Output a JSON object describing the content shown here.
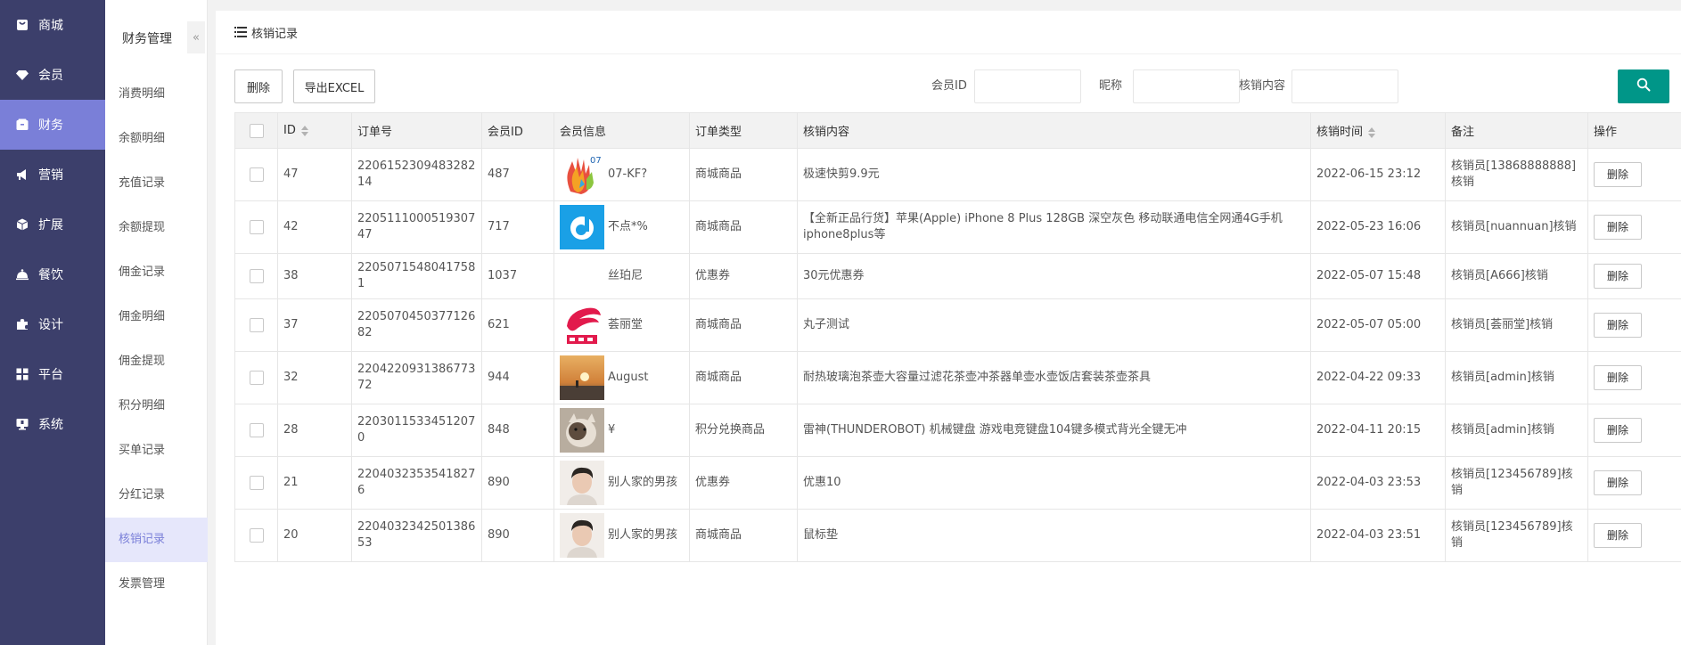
{
  "main_nav": [
    {
      "label": "商城",
      "icon": "bag-icon"
    },
    {
      "label": "会员",
      "icon": "diamond-icon"
    },
    {
      "label": "财务",
      "icon": "wallet-icon"
    },
    {
      "label": "营销",
      "icon": "megaphone-icon"
    },
    {
      "label": "扩展",
      "icon": "cube-icon"
    },
    {
      "label": "餐饮",
      "icon": "cloche-icon"
    },
    {
      "label": "设计",
      "icon": "puzzle-icon"
    },
    {
      "label": "平台",
      "icon": "grid-icon"
    },
    {
      "label": "系统",
      "icon": "monitor-icon"
    }
  ],
  "active_main_nav": "财务",
  "sub_nav": {
    "title": "财务管理",
    "collapse_glyph": "«",
    "items": [
      "消费明细",
      "余额明细",
      "充值记录",
      "余额提现",
      "佣金记录",
      "佣金明细",
      "佣金提现",
      "积分明细",
      "买单记录",
      "分红记录",
      "核销记录",
      "发票管理"
    ],
    "active": "核销记录"
  },
  "page": {
    "title": "核销记录"
  },
  "toolbar": {
    "delete_label": "删除",
    "export_label": "导出EXCEL",
    "filters": [
      {
        "label": "会员ID",
        "value": ""
      },
      {
        "label": "昵称",
        "value": ""
      },
      {
        "label": "核销内容",
        "value": ""
      }
    ],
    "accent_color": "#009688"
  },
  "table": {
    "columns": [
      "ID",
      "订单号",
      "会员ID",
      "会员信息",
      "订单类型",
      "核销内容",
      "核销时间",
      "备注",
      "操作"
    ],
    "sortable_columns": [
      "ID",
      "核销时间"
    ],
    "action_label": "删除",
    "rows": [
      {
        "id": "47",
        "order_no": "220615230948328214",
        "member_id": "487",
        "nickname": "07-KF?",
        "avatar": "colorful-hands",
        "order_type": "商城商品",
        "content": "极速快剪9.9元",
        "time": "2022-06-15 23:12",
        "remark": "核销员[13868888888]核销"
      },
      {
        "id": "42",
        "order_no": "220511100051930747",
        "member_id": "717",
        "nickname": "不点*%",
        "avatar": "blue-logo",
        "order_type": "商城商品",
        "content": "【全新正品行货】苹果(Apple) iPhone 8 Plus 128GB 深空灰色 移动联通电信全网通4G手机 iphone8plus等",
        "time": "2022-05-23 16:06",
        "remark": "核销员[nuannuan]核销"
      },
      {
        "id": "38",
        "order_no": "220507154804175​81",
        "member_id": "1037",
        "nickname": "丝珀尼",
        "avatar": "none",
        "order_type": "优惠券",
        "content": "30元优惠券",
        "time": "2022-05-07 15:48",
        "remark": "核销员[A666]核销"
      },
      {
        "id": "37",
        "order_no": "220507045037712682",
        "member_id": "621",
        "nickname": "荟丽堂",
        "avatar": "red-logo",
        "order_type": "商城商品",
        "content": "丸子测试",
        "time": "2022-05-07 05:00",
        "remark": "核销员[荟丽堂]核销"
      },
      {
        "id": "32",
        "order_no": "220422093138677372",
        "member_id": "944",
        "nickname": "August",
        "avatar": "sunset-photo",
        "order_type": "商城商品",
        "content": "耐热玻璃泡茶壶大容量过滤花茶壶冲茶器单壶水壶饭店套装茶壶茶具",
        "time": "2022-04-22 09:33",
        "remark": "核销员[admin]核销"
      },
      {
        "id": "28",
        "order_no": "22030115334512070",
        "member_id": "848",
        "nickname": "¥",
        "avatar": "cat-photo",
        "order_type": "积分兑换商品",
        "content": "雷神(THUNDEROBOT) 机械键盘 游戏电竞键盘104键多模式背光全键无冲",
        "time": "2022-04-11 20:15",
        "remark": "核销员[admin]核销"
      },
      {
        "id": "21",
        "order_no": "22040323535418276",
        "member_id": "890",
        "nickname": "别人家的男孩",
        "avatar": "boy-photo",
        "order_type": "优惠券",
        "content": "优惠10",
        "time": "2022-04-03 23:53",
        "remark": "核销员[123456789]核销"
      },
      {
        "id": "20",
        "order_no": "220403234250138653",
        "member_id": "890",
        "nickname": "别人家的男孩",
        "avatar": "boy-photo",
        "order_type": "商城商品",
        "content": "鼠标垫",
        "time": "2022-04-03 23:51",
        "remark": "核销员[123456789]核销"
      }
    ]
  }
}
